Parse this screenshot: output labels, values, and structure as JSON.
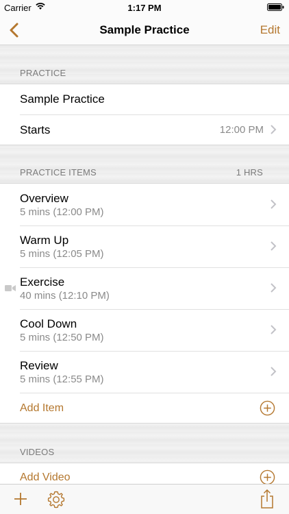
{
  "status_bar": {
    "carrier": "Carrier",
    "time": "1:17 PM"
  },
  "nav": {
    "title": "Sample Practice",
    "edit_label": "Edit"
  },
  "practice_section": {
    "header": "PRACTICE",
    "name": "Sample Practice",
    "starts_label": "Starts",
    "starts_value": "12:00 PM"
  },
  "items_section": {
    "header": "PRACTICE ITEMS",
    "total": "1 HRS",
    "items": [
      {
        "title": "Overview",
        "detail": "5 mins (12:00 PM)"
      },
      {
        "title": "Warm Up",
        "detail": "5 mins (12:05 PM)"
      },
      {
        "title": "Exercise",
        "detail": "40 mins (12:10 PM)",
        "icon": "video-camera-icon"
      },
      {
        "title": "Cool Down",
        "detail": "5 mins (12:50 PM)"
      },
      {
        "title": "Review",
        "detail": "5 mins (12:55 PM)"
      }
    ],
    "add_label": "Add Item"
  },
  "videos_section": {
    "header": "VIDEOS",
    "add_label": "Add Video"
  },
  "colors": {
    "accent": "#b4772e"
  }
}
